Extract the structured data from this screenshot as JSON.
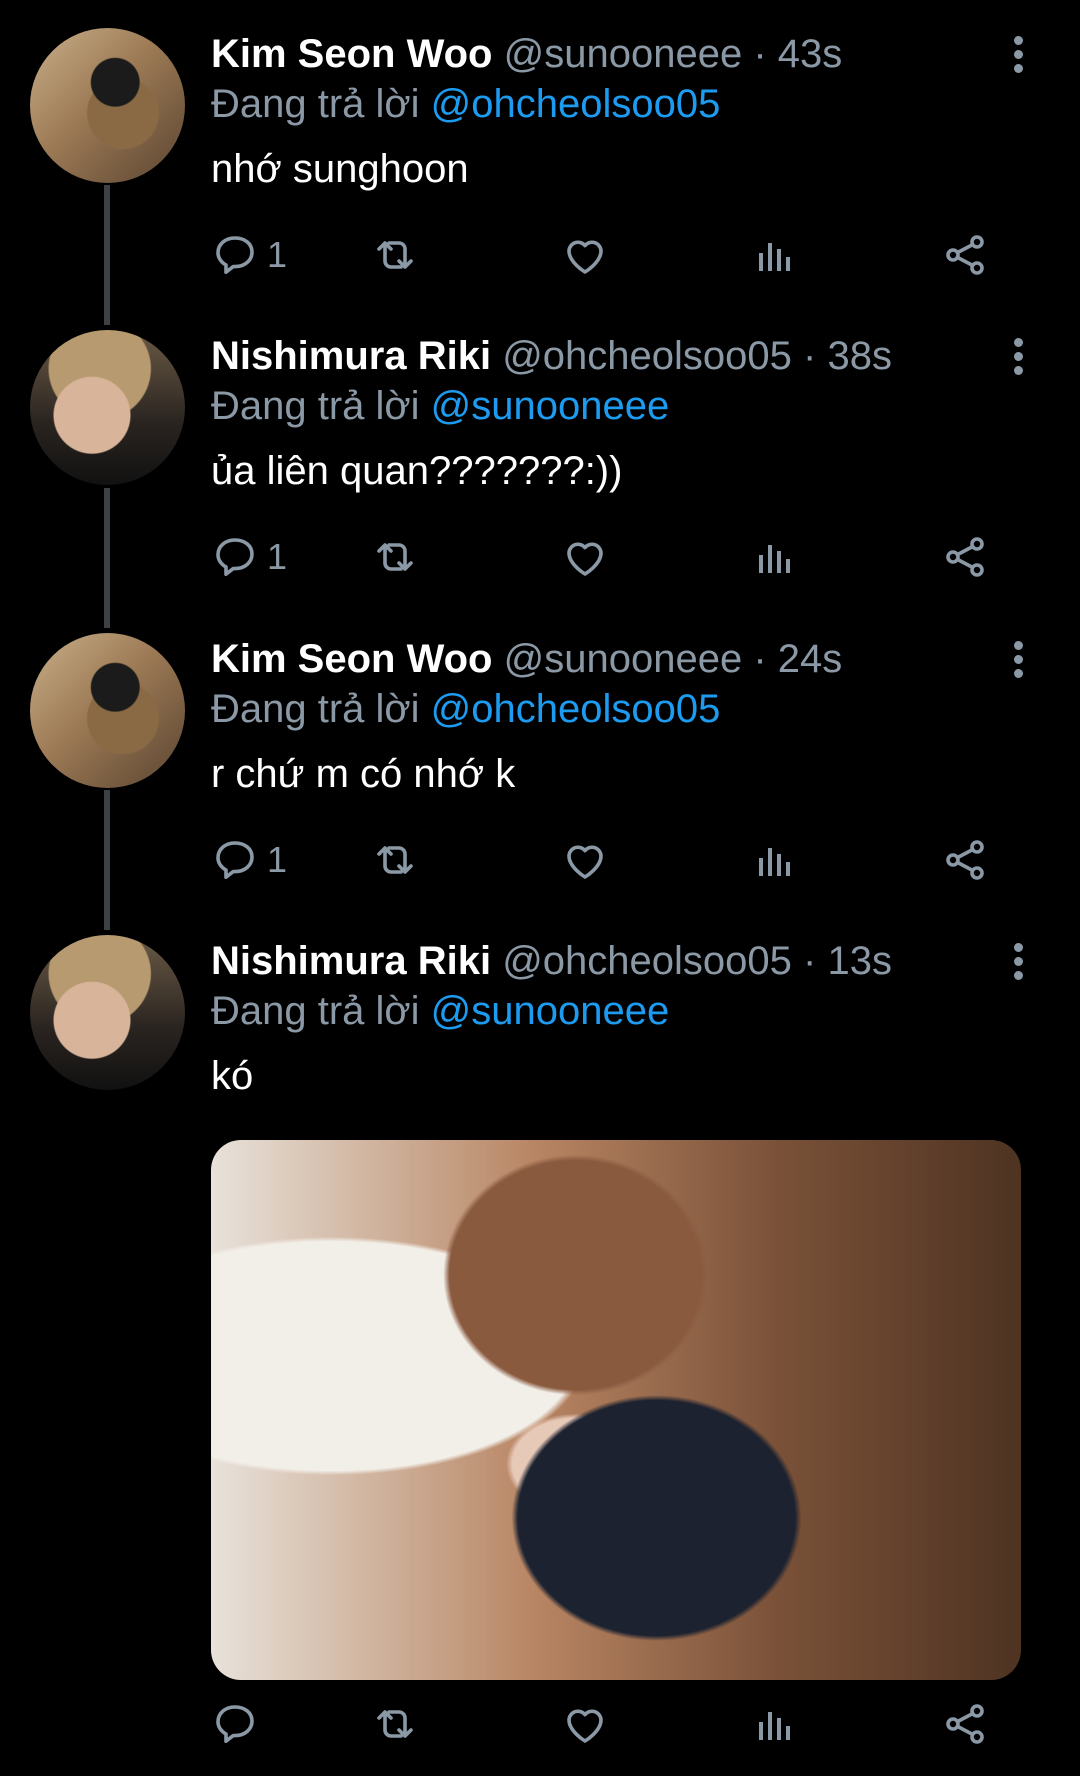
{
  "replying_prefix": "Đang trả lời",
  "tweets": [
    {
      "name": "Kim Seon Woo",
      "handle": "@sunooneee",
      "time": "· 43s",
      "reply_to": "@ohcheolsoo05",
      "text": "nhớ sunghoon",
      "reply_count": "1"
    },
    {
      "name": "Nishimura Riki",
      "handle": "@ohcheolsoo05",
      "time": "· 38s",
      "reply_to": "@sunooneee",
      "text": "ủa liên quan???????:))",
      "reply_count": "1"
    },
    {
      "name": "Kim Seon Woo",
      "handle": "@sunooneee",
      "time": "· 24s",
      "reply_to": "@ohcheolsoo05",
      "text": "r chứ m có nhớ k",
      "reply_count": "1"
    },
    {
      "name": "Nishimura Riki",
      "handle": "@ohcheolsoo05",
      "time": "· 13s",
      "reply_to": "@sunooneee",
      "text": "kó",
      "reply_count": ""
    }
  ],
  "colors": {
    "background": "#000000",
    "secondary_text": "#8b98a5",
    "mention": "#1d9bf0",
    "thread_line": "#3d4145"
  },
  "icons": [
    "reply-icon",
    "retweet-icon",
    "like-icon",
    "analytics-icon",
    "share-icon",
    "more-icon"
  ]
}
